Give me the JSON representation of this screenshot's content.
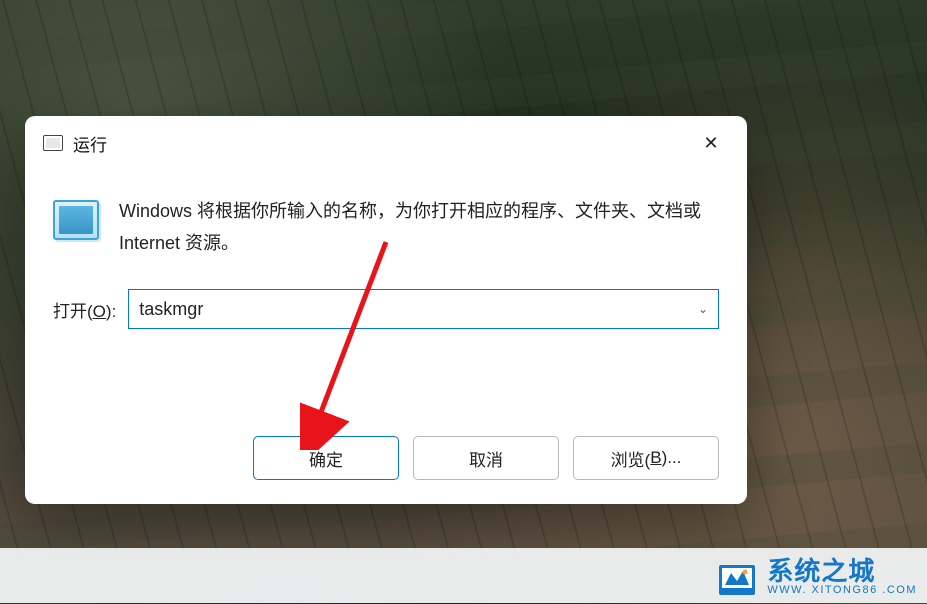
{
  "dialog": {
    "title": "运行",
    "description": "Windows 将根据你所输入的名称，为你打开相应的程序、文件夹、文档或 Internet 资源。",
    "input": {
      "label_prefix": "打开(",
      "label_key": "O",
      "label_suffix": "):",
      "value": "taskmgr"
    },
    "buttons": {
      "ok": "确定",
      "cancel": "取消",
      "browse_prefix": "浏览(",
      "browse_key": "B",
      "browse_suffix": ")..."
    }
  },
  "watermark": {
    "main": "系统之城",
    "sub": "WWW. XITONG86 .COM"
  }
}
